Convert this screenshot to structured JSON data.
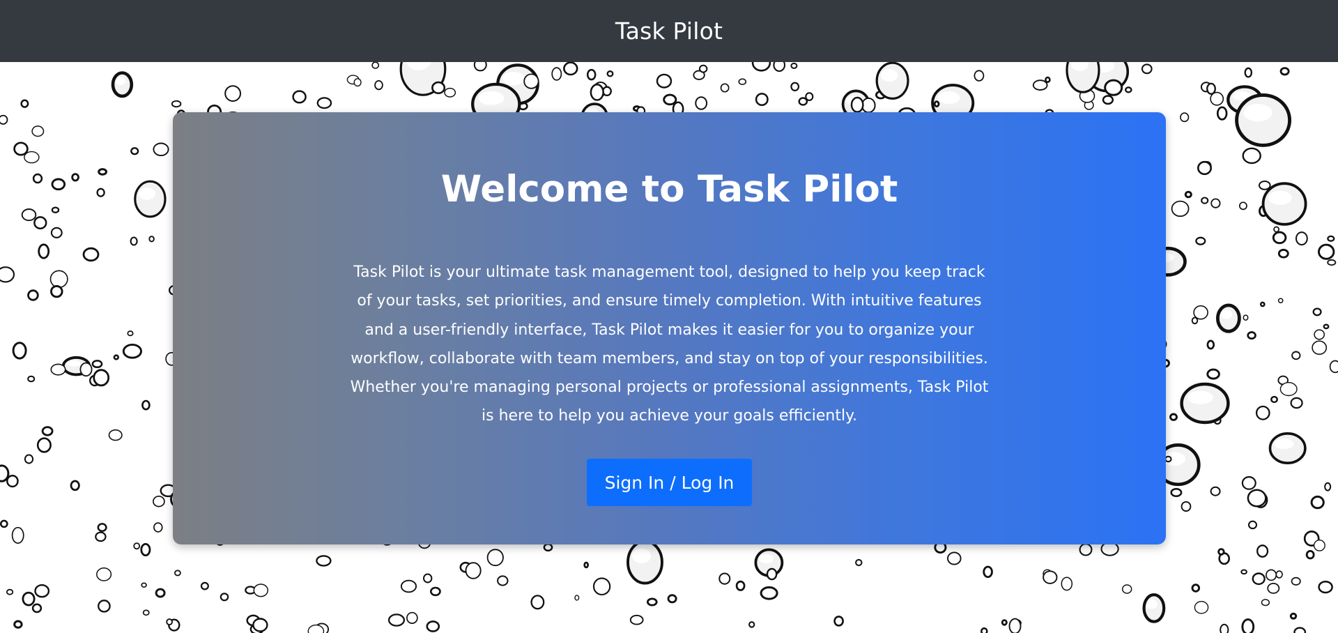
{
  "navbar": {
    "brand": "Task Pilot",
    "background_color": "#343a40"
  },
  "hero": {
    "title": "Welcome to Task Pilot",
    "description": "Task Pilot is your ultimate task management tool, designed to help you keep track of your tasks, set priorities, and ensure timely completion. With intuitive features and a user-friendly interface, Task Pilot makes it easier for you to organize your workflow, collaborate with team members, and stay on top of your responsibilities. Whether you're managing personal projects or professional assignments, Task Pilot is here to help you achieve your goals efficiently.",
    "button_label": "Sign In / Log In",
    "gradient_start_color": "#7c7f84",
    "gradient_end_color": "#2b72f4",
    "button_color": "#0d6efd"
  },
  "background": {
    "pattern": "water-droplets",
    "color": "#ffffff"
  }
}
